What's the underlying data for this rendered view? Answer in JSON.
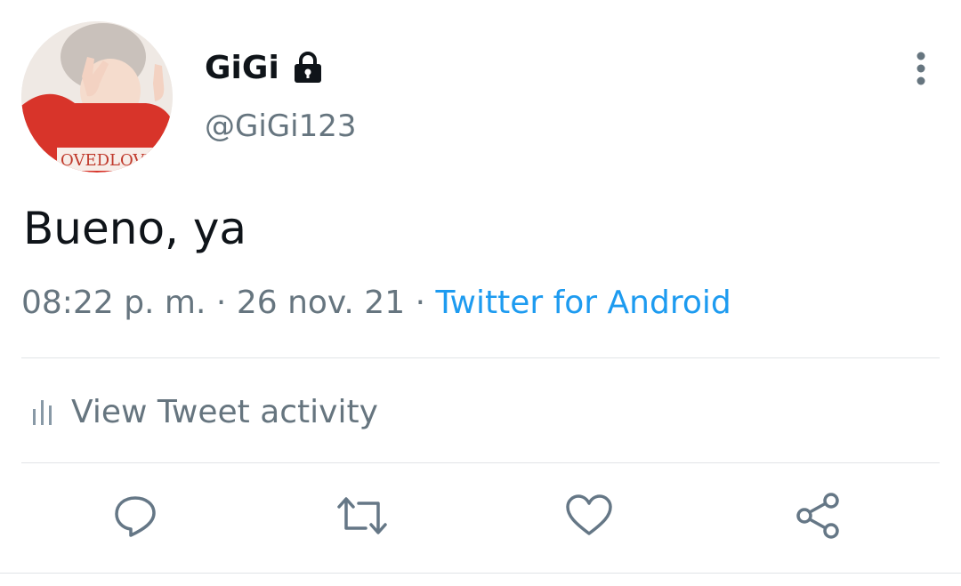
{
  "tweet": {
    "user": {
      "display_name": "GiGi",
      "handle": "@GiGi123",
      "protected_icon": "lock-icon",
      "avatar_shirt_text": "OVEDLOVE"
    },
    "text": "Bueno, ya",
    "meta": {
      "time": "08:22 p. m.",
      "separator": "·",
      "date": "26 nov. 21",
      "source": "Twitter for Android"
    },
    "activity": {
      "label": "View Tweet activity",
      "icon": "bar-chart-icon"
    },
    "actions": [
      {
        "name": "reply",
        "icon": "reply-icon"
      },
      {
        "name": "retweet",
        "icon": "retweet-icon"
      },
      {
        "name": "like",
        "icon": "heart-icon"
      },
      {
        "name": "share",
        "icon": "share-icon"
      }
    ]
  },
  "colors": {
    "text_primary": "#0f1419",
    "text_secondary": "#66757f",
    "link": "#1d9bf0",
    "divider": "#e1e4e7",
    "icon": "#657786"
  }
}
